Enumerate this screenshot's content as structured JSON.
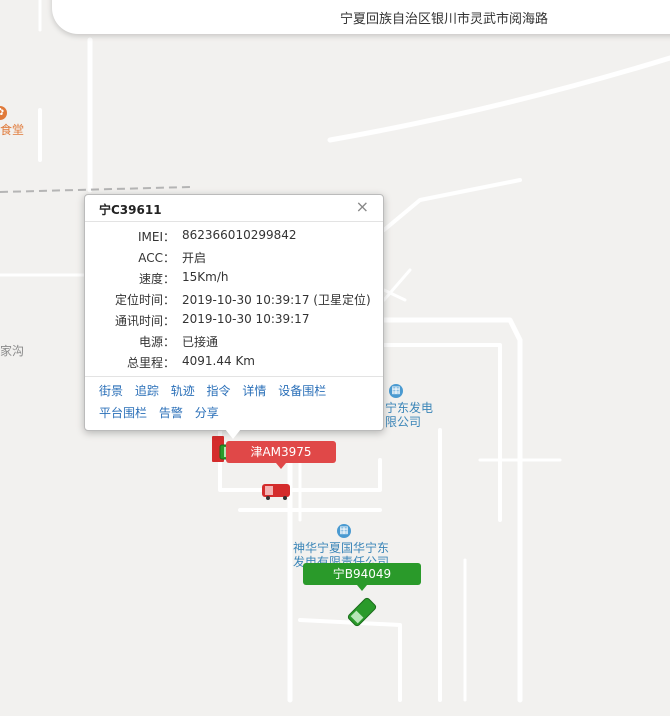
{
  "address_bar": {
    "address": "宁夏回族自治区银川市灵武市阅海路"
  },
  "map": {
    "pois": [
      {
        "label": "食堂",
        "style": "orange"
      },
      {
        "label": "家沟",
        "style": "grey"
      },
      {
        "label": "宁东发电\n限公司",
        "style": "blue"
      },
      {
        "label": "神华宁夏国华宁东\n发电有限责任公司",
        "style": "blue"
      }
    ]
  },
  "popup": {
    "title": "宁C39611",
    "close_glyph": "×",
    "rows": [
      {
        "label": "IMEI：",
        "value": "862366010299842"
      },
      {
        "label": "ACC：",
        "value": "开启"
      },
      {
        "label": "速度：",
        "value": "15Km/h"
      },
      {
        "label": "定位时间：",
        "value": "2019-10-30 10:39:17 (卫星定位)"
      },
      {
        "label": "通讯时间：",
        "value": "2019-10-30 10:39:17"
      },
      {
        "label": "电源：",
        "value": "已接通"
      },
      {
        "label": "总里程：",
        "value": "4091.44 Km"
      }
    ],
    "links_row1": [
      "街景",
      "追踪",
      "轨迹",
      "指令",
      "详情",
      "设备围栏"
    ],
    "links_row2": [
      "平台围栏",
      "告警",
      "分享"
    ]
  },
  "vehicles": [
    {
      "plate": "津AM3975",
      "color": "#e04848"
    },
    {
      "plate": "宁B94049",
      "color": "#2a9a2a"
    }
  ],
  "colors": {
    "road": "#ffffff",
    "background": "#f2f1ef",
    "link": "#2a6fb8"
  }
}
